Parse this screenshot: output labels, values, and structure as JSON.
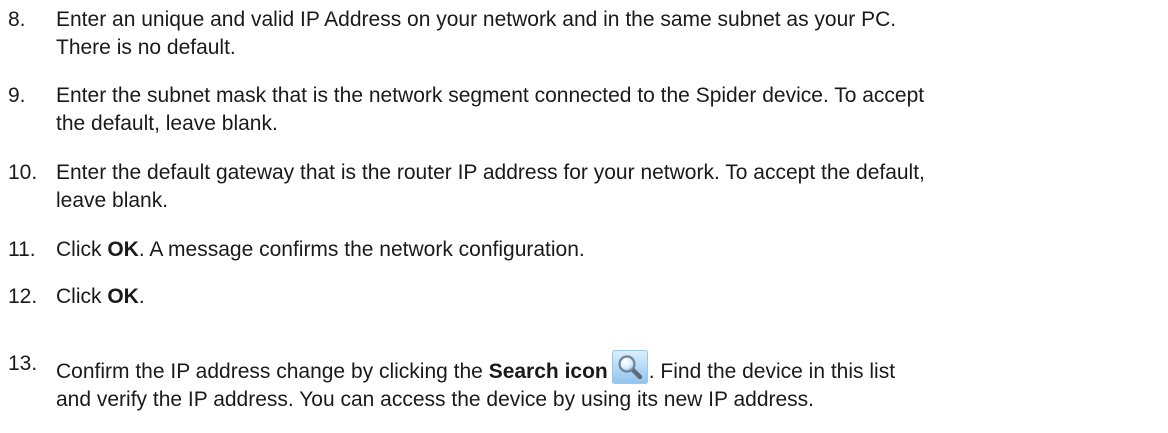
{
  "steps": [
    {
      "number": "8.",
      "line1": "Enter an unique and valid IP Address on your network and in the same subnet as your PC.",
      "line2": "There is no default."
    },
    {
      "number": "9.",
      "line1": "Enter the subnet mask that is the network segment connected to the Spider device. To accept",
      "line2": "the default, leave blank."
    },
    {
      "number": "10.",
      "line1": "Enter the default gateway that is the router IP address for your network. To accept the default,",
      "line2": "leave blank."
    },
    {
      "number": "11.",
      "prefix": "Click ",
      "bold": "OK",
      "suffix": ". A message confirms the network configuration."
    },
    {
      "number": "12.",
      "prefix": "Click ",
      "bold": "OK",
      "suffix": "."
    },
    {
      "number": "13.",
      "prefix": "Confirm the IP address change by clicking the ",
      "bold": "Search icon",
      "suffix": ". Find the device in this list",
      "line2": "and verify the IP address. You can access the device by using its new IP address.",
      "icon": "search-icon"
    }
  ]
}
